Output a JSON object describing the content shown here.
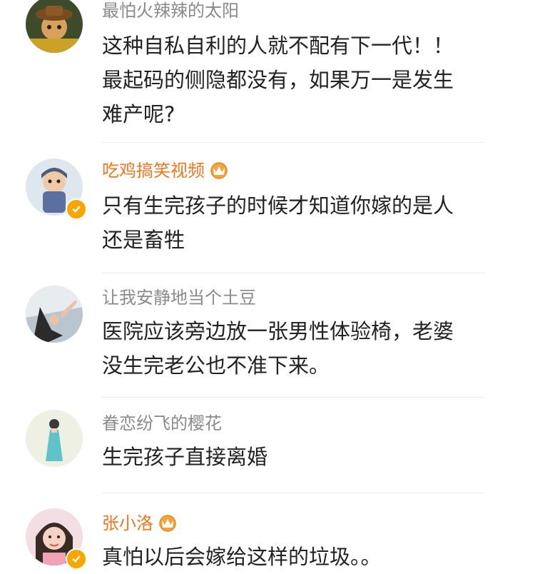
{
  "comments": [
    {
      "username": "最怕火辣辣的太阳",
      "text": "这种自私自利的人就不配有下一代！！最起码的侧隐都没有，如果万一是发生难产呢?",
      "vip": false
    },
    {
      "username": "吃鸡搞笑视频",
      "text": "只有生完孩子的时候才知道你嫁的是人还是畜牲",
      "vip": true
    },
    {
      "username": "让我安静地当个土豆",
      "text": "医院应该旁边放一张男性体验椅，老婆没生完老公也不准下来。",
      "vip": false
    },
    {
      "username": "眷恋纷飞的樱花",
      "text": "生完孩子直接离婚",
      "vip": false
    },
    {
      "username": "张小洛",
      "text": "真怕以后会嫁给这样的垃圾。。",
      "vip": true
    }
  ],
  "colors": {
    "username_default": "#8a8a8a",
    "username_vip": "#f0761f",
    "verified_badge": "#f7a600",
    "text": "#222222"
  }
}
